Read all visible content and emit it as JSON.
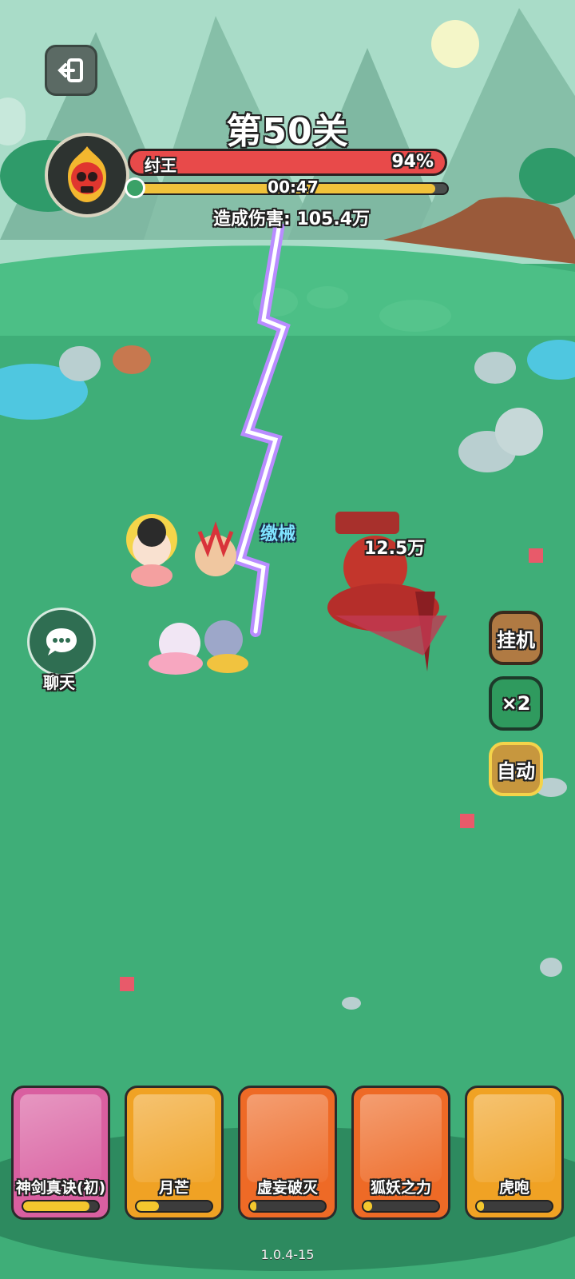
{
  "level": {
    "title": "第50关"
  },
  "boss": {
    "name": "纣王",
    "hp_percent_label": "94%",
    "hp_fraction": 0.94
  },
  "timer": {
    "text": "00:47",
    "fraction": 0.96
  },
  "damage": {
    "label": "造成伤害:",
    "value": "105.4万"
  },
  "battle": {
    "status_text": "缴械",
    "damage_popup": "12.5万"
  },
  "side_buttons": {
    "idle": "挂机",
    "speed": "×2",
    "auto": "自动"
  },
  "chat": {
    "label": "聊天"
  },
  "skills": [
    {
      "name": "神剑真诀(初)",
      "progress": 0.88,
      "color": "#d95fa0"
    },
    {
      "name": "月芒",
      "progress": 0.3,
      "color": "#f0a224"
    },
    {
      "name": "虚妄破灭",
      "progress": 0.08,
      "color": "#ee6a26"
    },
    {
      "name": "狐妖之力",
      "progress": 0.12,
      "color": "#ee6a26"
    },
    {
      "name": "虎咆",
      "progress": 0.1,
      "color": "#f0a224"
    }
  ],
  "version": "1.0.4-15",
  "icons": {
    "exit": "exit-icon",
    "boss": "skull-flame-icon",
    "clock": "clock-icon",
    "chat": "chat-bubble-icon"
  },
  "colors": {
    "hp": "#e84a4a",
    "timer": "#f0c23b",
    "ground": "#3fae78"
  }
}
